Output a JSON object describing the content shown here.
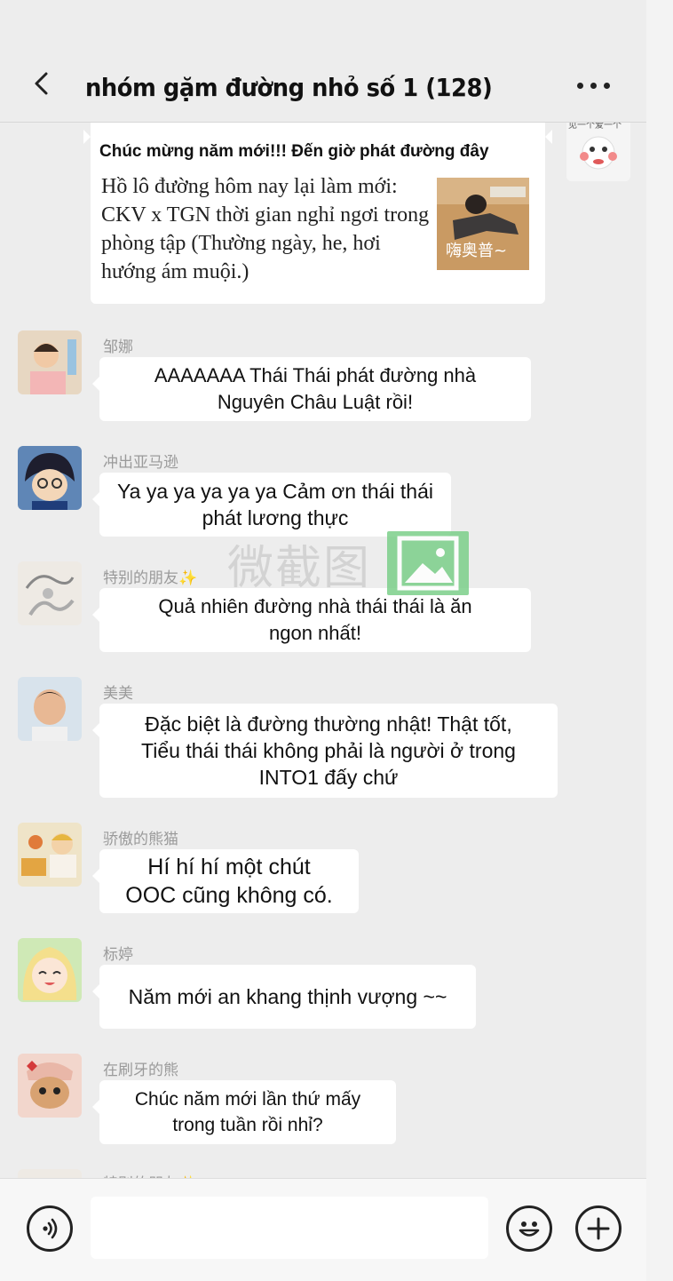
{
  "header": {
    "title": "nhóm gặm đường nhỏ số 1 (128)"
  },
  "shared_card": {
    "title": "Chúc mừng năm mới!!! Đến giờ phát đường đây",
    "description": "Hồ lô đường hôm nay lại làm mới: CKV x TGN thời gian nghỉ ngơi trong phòng tập (Thường ngày, he, hơi hướng ám muội.)",
    "thumbnail_caption": "嗨奥普~",
    "sticker_text": "见一个爱一个"
  },
  "messages": [
    {
      "sender": "邹娜",
      "text": "AAAAAAA Thái Thái phát đường nhà\nNguyên Châu Luật rồi!"
    },
    {
      "sender": "冲出亚马逊",
      "text": "Ya ya ya ya ya ya Cảm ơn thái thái\nphát lương thực"
    },
    {
      "sender": "特别的朋友✨",
      "text": "Quả nhiên đường nhà thái thái là ăn\nngon nhất!"
    },
    {
      "sender": "美美",
      "text": "Đặc biệt là đường thường nhật! Thật tốt,\nTiểu thái thái không phải là người ở trong\nINTO1 đấy chứ"
    },
    {
      "sender": "骄傲的熊猫",
      "text": "Hí hí hí một chút\nOOC cũng không có."
    },
    {
      "sender": "标婷",
      "text": "Năm mới an khang thịnh vượng ~~"
    },
    {
      "sender": "在刷牙的熊",
      "text": "Chúc năm mới lần thứ mấy\ntrong tuần rồi nhỉ?"
    },
    {
      "sender": "特别的朋友✨",
      "text": ""
    }
  ],
  "watermark": {
    "text": "微截图"
  },
  "input_bar": {
    "message_value": ""
  },
  "icons": {
    "back": "back-arrow-icon",
    "more": "more-dots-icon",
    "voice": "voice-icon",
    "emoji": "emoji-icon",
    "plus": "plus-icon"
  }
}
